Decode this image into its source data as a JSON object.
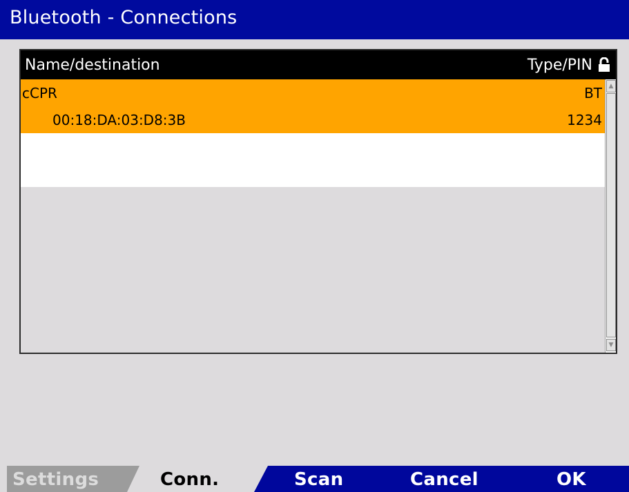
{
  "window": {
    "title": "Bluetooth - Connections"
  },
  "table": {
    "columns": [
      "Name/destination",
      "Type/PIN"
    ],
    "rows": [
      {
        "name": "cCPR",
        "type": "BT",
        "address": "00:18:DA:03:D8:3B",
        "pin": "1234",
        "selected": true
      }
    ]
  },
  "softkeys": {
    "settings": "Settings",
    "conn": "Conn.",
    "scan": "Scan",
    "cancel": "Cancel",
    "ok": "OK"
  },
  "colors": {
    "title_bar": "#000a9e",
    "selection": "#ffa400",
    "background": "#dddbdd",
    "softkey_bar": "#00079c"
  },
  "icons": {
    "header_right": "lock-icon"
  }
}
